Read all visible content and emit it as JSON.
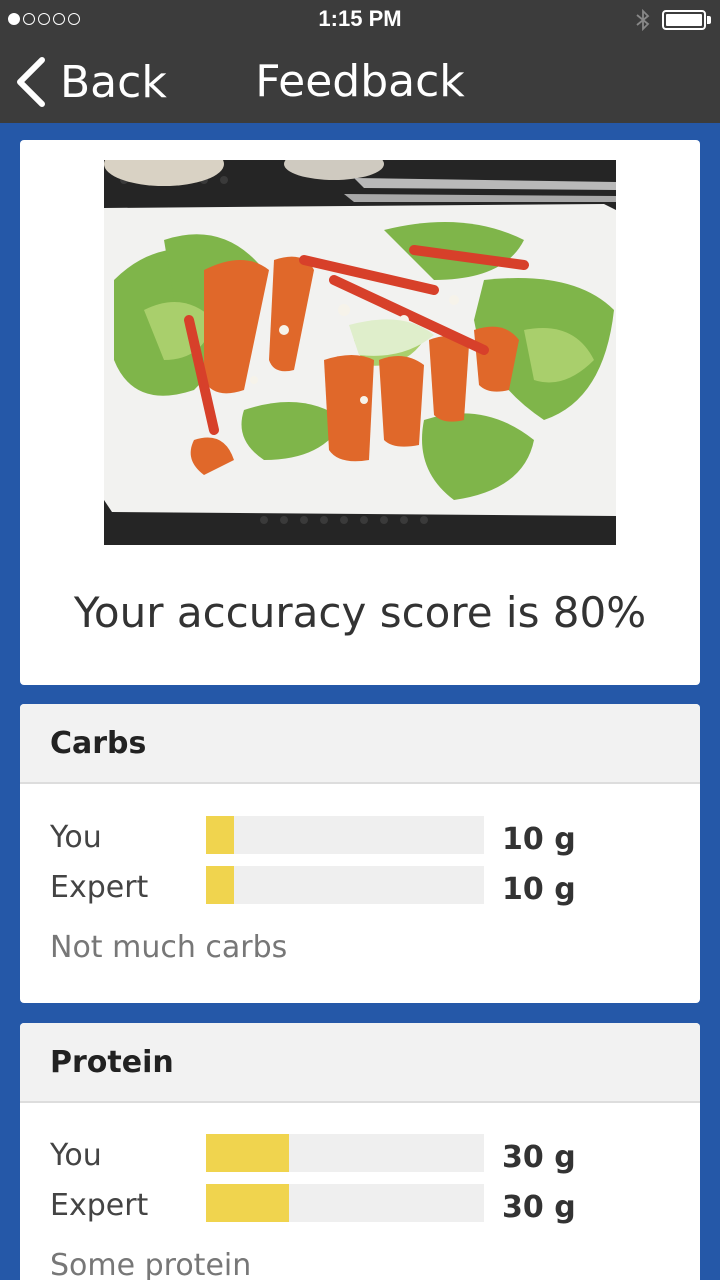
{
  "status_bar": {
    "time": "1:15 PM",
    "signal_total": 5,
    "signal_filled": 1,
    "battery_level": 1.0
  },
  "nav": {
    "back_label": "Back",
    "title": "Feedback"
  },
  "feedback": {
    "score_text": "Your accuracy score is 80%"
  },
  "nutrients": [
    {
      "name": "Carbs",
      "max": 100,
      "you_label": "You",
      "you_value": 10,
      "you_text": "10 g",
      "expert_label": "Expert",
      "expert_value": 10,
      "expert_text": "10 g",
      "note": "Not much carbs"
    },
    {
      "name": "Protein",
      "max": 100,
      "you_label": "You",
      "you_value": 30,
      "you_text": "30 g",
      "expert_label": "Expert",
      "expert_value": 30,
      "expert_text": "30 g",
      "note": "Some protein"
    }
  ],
  "colors": {
    "background": "#2558a8",
    "bar_fill": "#f0d44e",
    "bar_track": "#efefef",
    "header": "#3c3c3c"
  }
}
